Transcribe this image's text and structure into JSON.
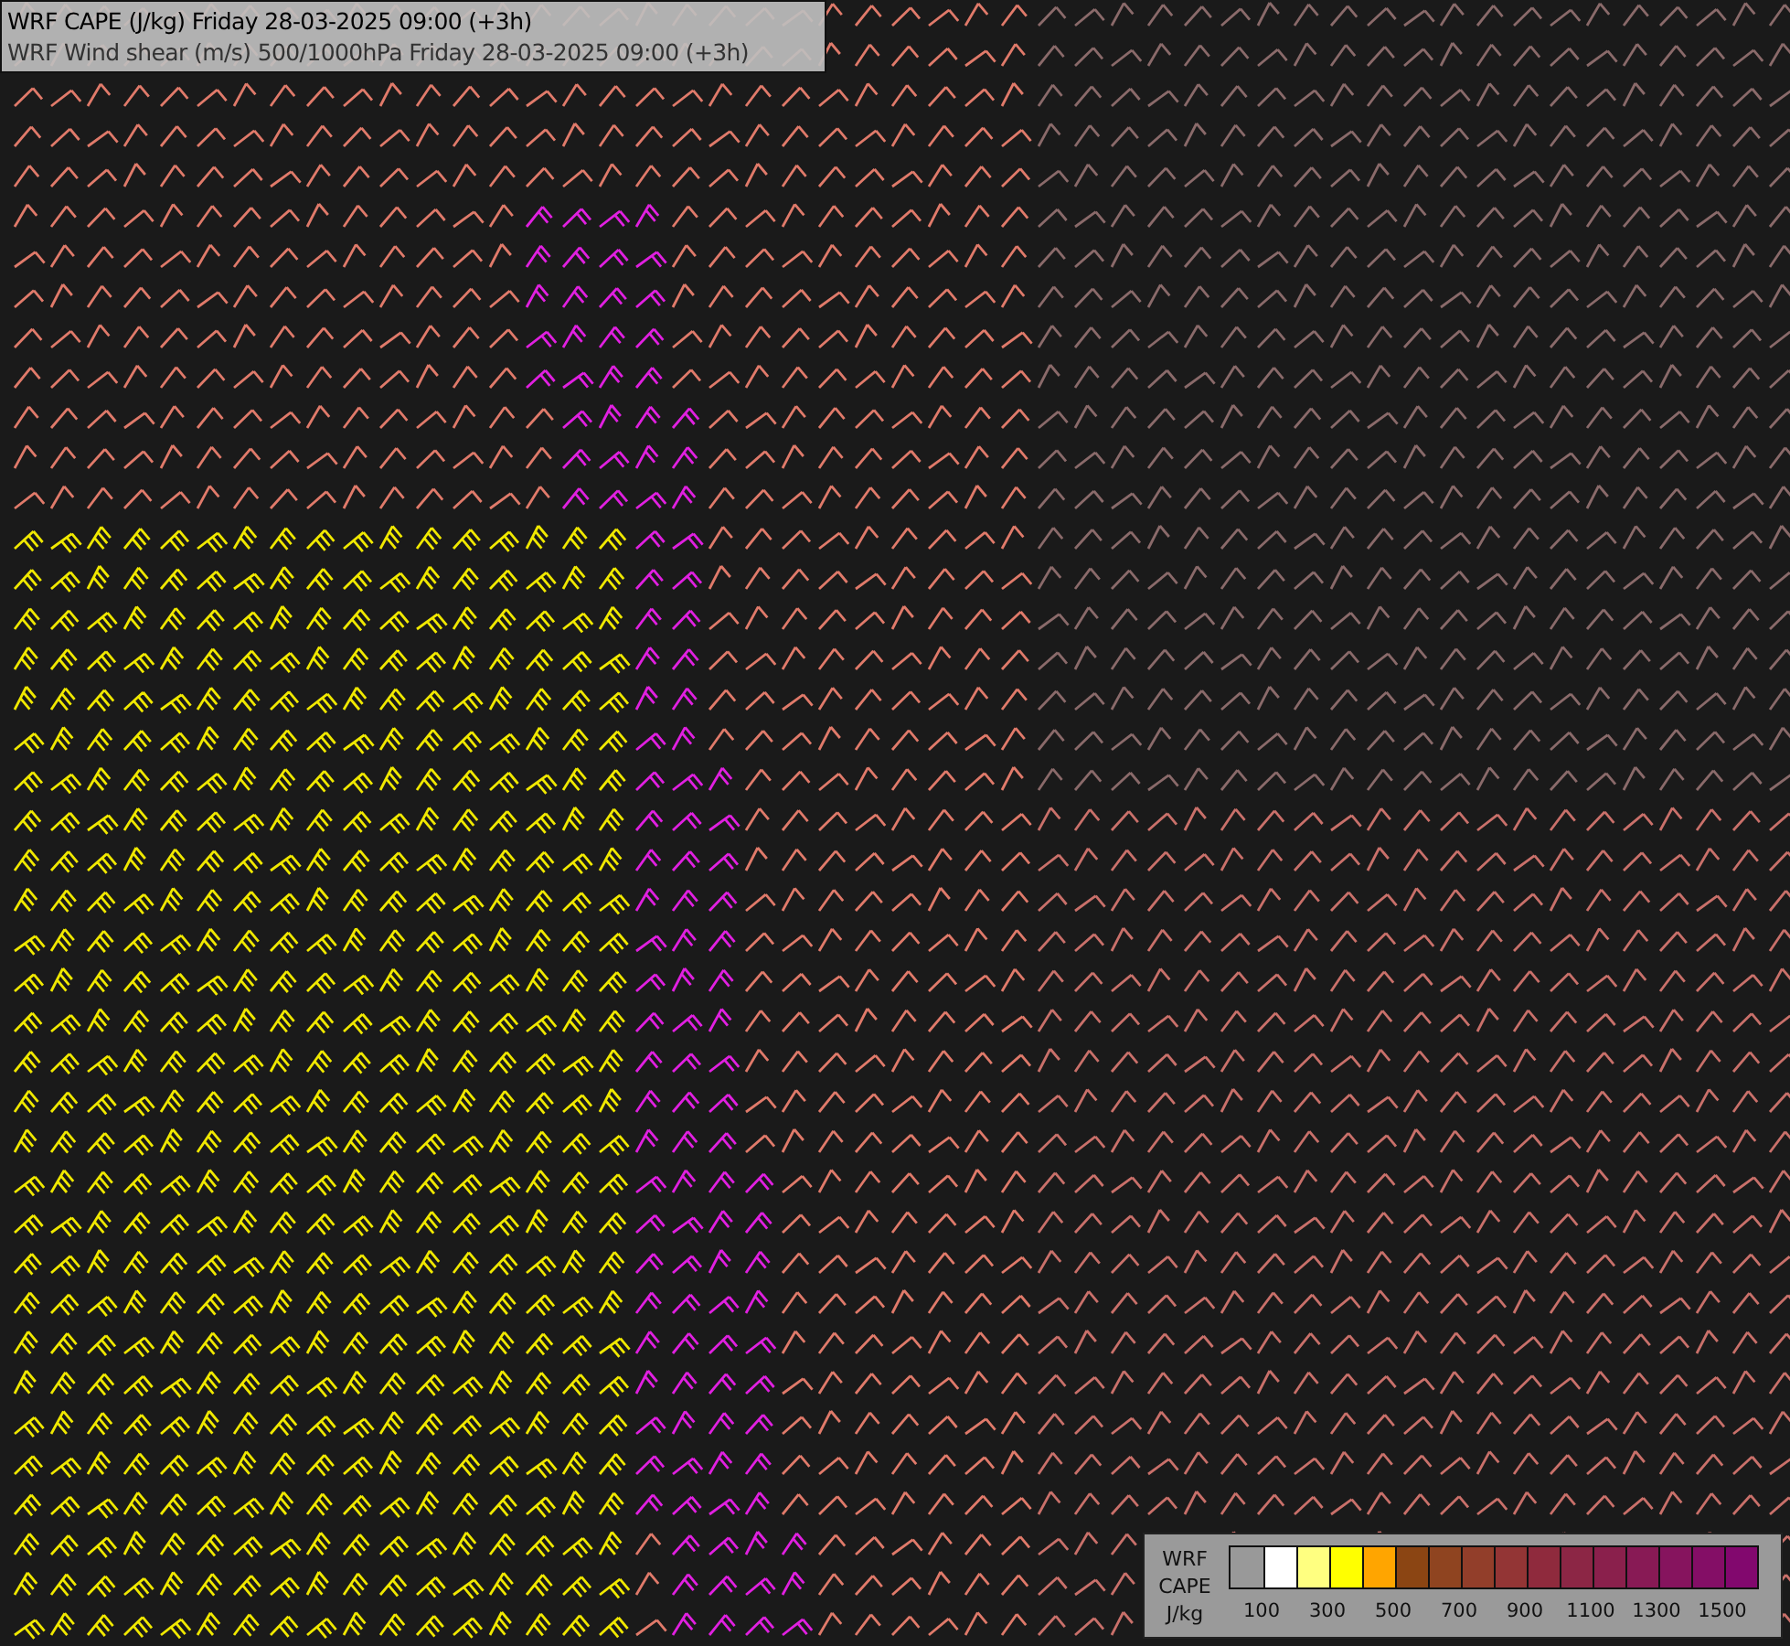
{
  "title_box": {
    "lines": [
      "WRF CAPE (J/kg) Friday 28-03-2025 09:00 (+3h)",
      "WRF Wind shear (m/s) 500/1000hPa Friday 28-03-2025 09:00 (+3h)"
    ]
  },
  "legend": {
    "title_lines": [
      "WRF",
      "CAPE",
      "J/kg"
    ],
    "bins": [
      {
        "color": "#999999"
      },
      {
        "color": "#ffffff"
      },
      {
        "color": "#ffff80"
      },
      {
        "color": "#ffff00"
      },
      {
        "color": "#ffa500"
      },
      {
        "color": "#8b4513"
      },
      {
        "color": "#8f4420"
      },
      {
        "color": "#923e2a"
      },
      {
        "color": "#933535"
      },
      {
        "color": "#8f2a3d"
      },
      {
        "color": "#8c2645"
      },
      {
        "color": "#8a204c"
      },
      {
        "color": "#881a55"
      },
      {
        "color": "#86145e"
      },
      {
        "color": "#840e66"
      },
      {
        "color": "#82086e"
      }
    ],
    "tick_labels": [
      "100",
      "300",
      "500",
      "700",
      "900",
      "1100",
      "1300",
      "1500"
    ]
  }
}
